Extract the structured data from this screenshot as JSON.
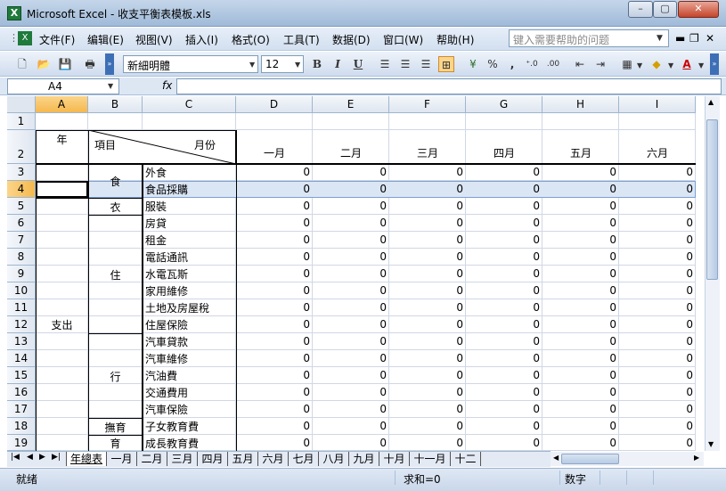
{
  "window": {
    "title": "Microsoft Excel - 收支平衡表模板.xls",
    "icon": "excel-app-icon",
    "min": "–",
    "max": "▢",
    "close": "✕"
  },
  "menu": [
    "文件(F)",
    "编辑(E)",
    "视图(V)",
    "插入(I)",
    "格式(O)",
    "工具(T)",
    "数据(D)",
    "窗口(W)",
    "帮助(H)"
  ],
  "help_placeholder": "键入需要帮助的问题",
  "toolbar": {
    "font": "新細明體",
    "size": "12",
    "bold": "B",
    "italic": "I",
    "underline": "U"
  },
  "formula_bar": {
    "name_box": "A4",
    "fx": "fx",
    "value": ""
  },
  "columns": [
    "A",
    "B",
    "C",
    "D",
    "E",
    "F",
    "G",
    "H",
    "I"
  ],
  "selected_column": "A",
  "selected_row": "4",
  "rows": [
    "1",
    "2",
    "3",
    "4",
    "5",
    "6",
    "7",
    "8",
    "9",
    "10",
    "11",
    "12",
    "13",
    "14",
    "15",
    "16",
    "17",
    "18",
    "19"
  ],
  "sheet": {
    "year_label": "年",
    "item_label": "項目",
    "month_label": "月份",
    "months": [
      "一月",
      "二月",
      "三月",
      "四月",
      "五月",
      "六月"
    ],
    "expense_label": "支出",
    "groups": [
      {
        "name": "食",
        "items": [
          "外食",
          "食品採購"
        ]
      },
      {
        "name": "衣",
        "items": [
          "服裝"
        ]
      },
      {
        "name": "住",
        "items": [
          "房貸",
          "租金",
          "電話通訊",
          "水電瓦斯",
          "家用維修",
          "土地及房屋稅",
          "住屋保險"
        ]
      },
      {
        "name": "行",
        "items": [
          "汽車貸款",
          "汽車維修",
          "汽油費",
          "交通費用",
          "汽車保險"
        ]
      },
      {
        "name": "撫育",
        "items": [
          "子女教育費"
        ]
      },
      {
        "name": "育",
        "items": [
          "成長教育費"
        ]
      }
    ],
    "zero": "0"
  },
  "tabs": [
    "年總表",
    "一月",
    "二月",
    "三月",
    "四月",
    "五月",
    "六月",
    "七月",
    "八月",
    "九月",
    "十月",
    "十一月",
    "十二"
  ],
  "status": {
    "ready": "就绪",
    "sum": "求和=0",
    "numlock": "数字"
  }
}
